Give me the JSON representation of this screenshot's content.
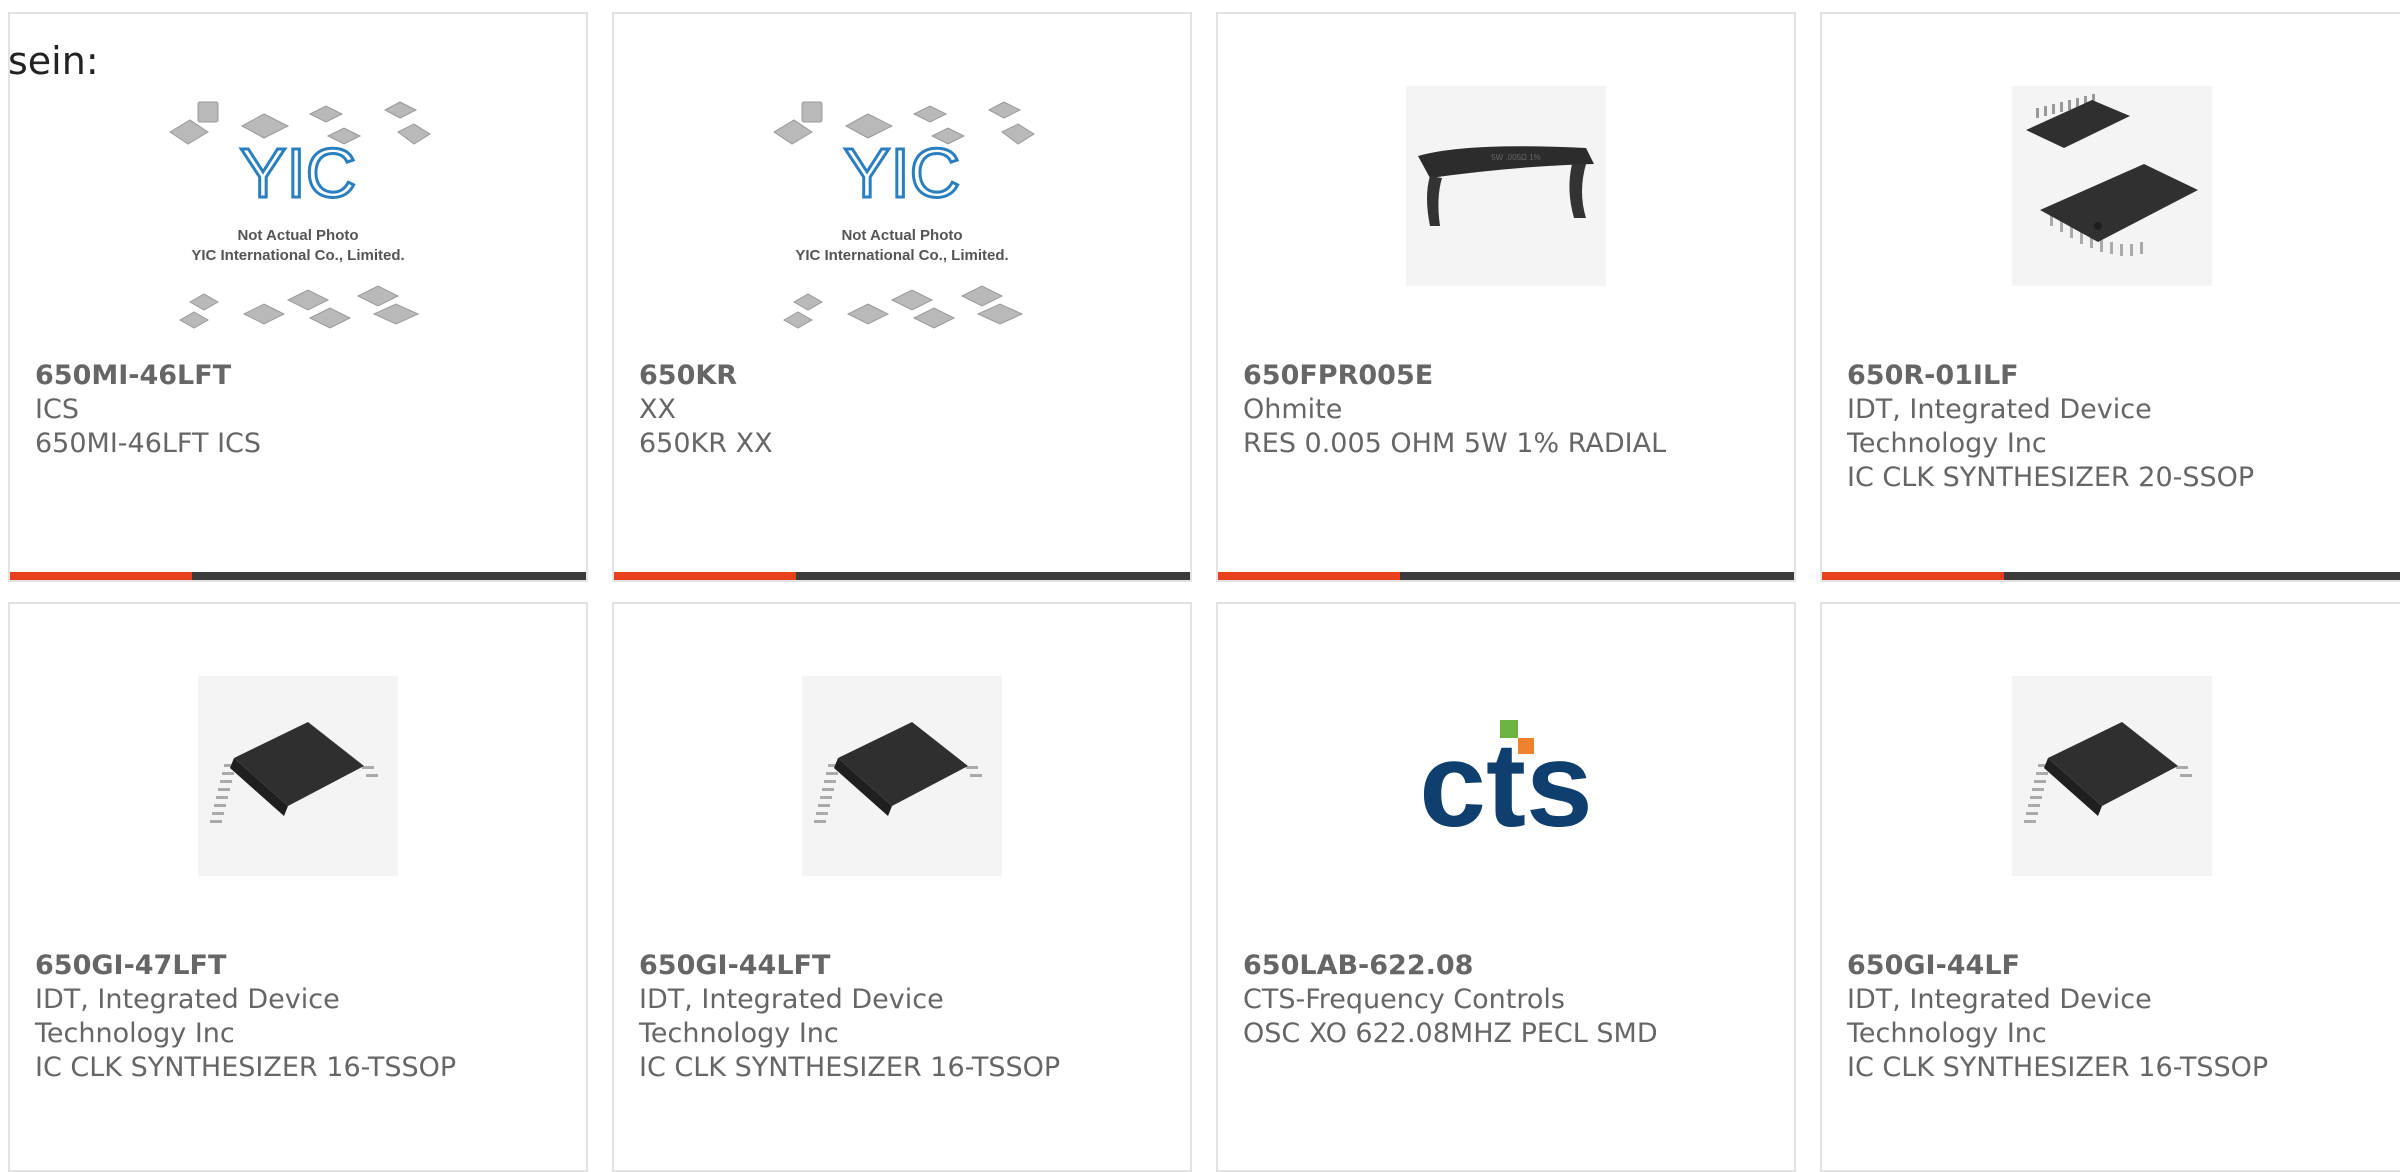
{
  "page": {
    "label": "sein:"
  },
  "colors": {
    "accent": "#e8401c",
    "bar_dark": "#3b3b3b",
    "card_border": "#e3e3e3",
    "text": "#666666",
    "yic_blue": "#2a7fc0",
    "cts_navy": "#0f3f6e",
    "cts_green": "#6cb43f",
    "cts_orange": "#f0822d"
  },
  "cards": [
    {
      "part": "650MI-46LFT",
      "manufacturer": "ICS",
      "description": "650MI-46LFT ICS",
      "image": "yic-placeholder-image",
      "placeholder_brand": "YIC",
      "placeholder_line1": "Not Actual Photo",
      "placeholder_line2": "YIC International Co., Limited."
    },
    {
      "part": "650KR",
      "manufacturer": "XX",
      "description": "650KR XX",
      "image": "yic-placeholder-image",
      "placeholder_brand": "YIC",
      "placeholder_line1": "Not Actual Photo",
      "placeholder_line2": "YIC International Co., Limited."
    },
    {
      "part": "650FPR005E",
      "manufacturer": "Ohmite",
      "description": "RES 0.005 OHM 5W 1% RADIAL",
      "image": "shunt-resistor-image",
      "component_marking": "5W .005Ω 1%"
    },
    {
      "part": "650R-01ILF",
      "manufacturer": "IDT, Integrated Device Technology Inc",
      "description": "IC CLK SYNTHESIZER 20-SSOP",
      "image": "ssop-chip-image"
    },
    {
      "part": "650GI-47LFT",
      "manufacturer": "IDT, Integrated Device Technology Inc",
      "description": "IC CLK SYNTHESIZER 16-TSSOP",
      "image": "tssop-chip-image"
    },
    {
      "part": "650GI-44LFT",
      "manufacturer": "IDT, Integrated Device Technology Inc",
      "description": "IC CLK SYNTHESIZER 16-TSSOP",
      "image": "tssop-chip-image"
    },
    {
      "part": "650LAB-622.08",
      "manufacturer": "CTS-Frequency Controls",
      "description": "OSC XO 622.08MHZ PECL SMD",
      "image": "cts-logo-image",
      "logo_text": "cts"
    },
    {
      "part": "650GI-44LF",
      "manufacturer": "IDT, Integrated Device Technology Inc",
      "description": "IC CLK SYNTHESIZER 16-TSSOP",
      "image": "tssop-chip-image"
    }
  ]
}
